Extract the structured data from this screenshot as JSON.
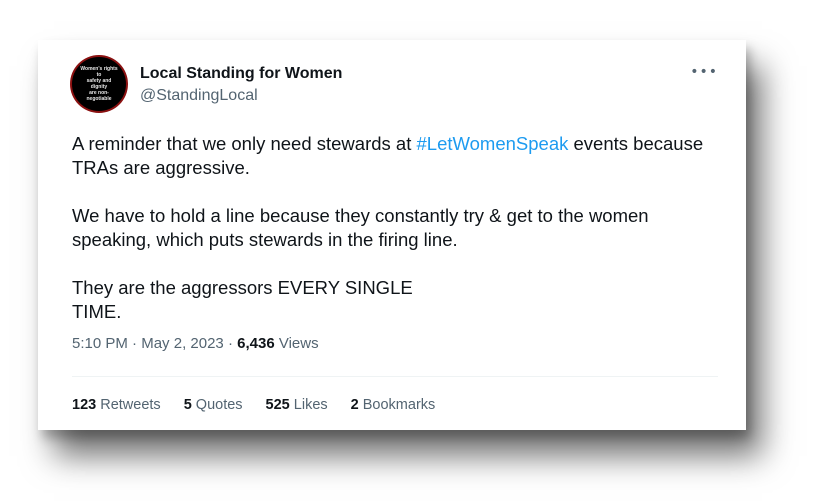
{
  "author": {
    "display_name": "Local Standing for Women",
    "handle": "@StandingLocal",
    "avatar_text": "Women's rights to\nsafety and dignity\nare non-negotiable"
  },
  "more_icon": "more-horizontal-icon",
  "tweet": {
    "p1_before": "A reminder that we only need stewards at ",
    "p1_hashtag": "#LetWomenSpeak",
    "p1_after": " events because TRAs are aggressive.",
    "p2": "We have to hold a line because they constantly try & get to the women speaking, which puts stewards in the firing line.",
    "p3_line1": "They are the aggressors EVERY SINGLE",
    "p3_line2": "TIME."
  },
  "meta": {
    "time": "5:10 PM",
    "separator": "·",
    "date": "May 2, 2023",
    "views_count": "6,436",
    "views_label": "Views"
  },
  "stats": {
    "retweets_count": "123",
    "retweets_label": "Retweets",
    "quotes_count": "5",
    "quotes_label": "Quotes",
    "likes_count": "525",
    "likes_label": "Likes",
    "bookmarks_count": "2",
    "bookmarks_label": "Bookmarks"
  },
  "colors": {
    "hashtag": "#1d9bf0",
    "text_primary": "#0f1419",
    "text_secondary": "#536471",
    "avatar_ring": "#8b1111"
  }
}
